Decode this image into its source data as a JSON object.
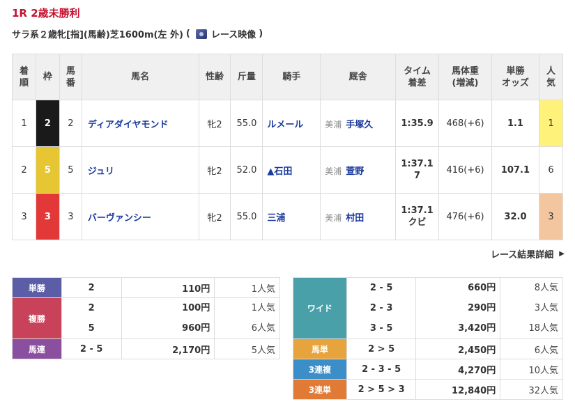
{
  "race": {
    "title": "1R 2歳未勝利",
    "condition": "サラ系２歳牝[指](馬齢)芝1600m(左 外)",
    "video_open": "(",
    "video_label": "レース映像",
    "video_close": ")"
  },
  "headers": {
    "rank": "着\n順",
    "waku": "枠",
    "umaban": "馬\n番",
    "name": "馬名",
    "sexage": "性齢",
    "weight": "斤量",
    "jockey": "騎手",
    "stable": "厩舎",
    "time": "タイム\n着差",
    "body": "馬体重\n(増減)",
    "odds": "単勝\nオッズ",
    "pop": "人\n気"
  },
  "rows": [
    {
      "rank": "1",
      "waku": "2",
      "waku_bg": "#1a1a1a",
      "waku_fg": "#ffffff",
      "umaban": "2",
      "name": "ディアダイヤモンド",
      "sexage": "牝2",
      "weight": "55.0",
      "jockey": "ルメール",
      "loc": "美浦",
      "trainer": "手塚久",
      "time": "1:35.9",
      "margin": "",
      "body": "468(+6)",
      "odds": "1.1",
      "pop": "1"
    },
    {
      "rank": "2",
      "waku": "5",
      "waku_bg": "#e6c733",
      "waku_fg": "#ffffff",
      "umaban": "5",
      "name": "ジュリ",
      "sexage": "牝2",
      "weight": "52.0",
      "jockey": "▲石田",
      "loc": "美浦",
      "trainer": "萱野",
      "time": "1:37.1",
      "margin": "7",
      "body": "416(+6)",
      "odds": "107.1",
      "pop": "6"
    },
    {
      "rank": "3",
      "waku": "3",
      "waku_bg": "#e23838",
      "waku_fg": "#ffffff",
      "umaban": "3",
      "name": "バーヴァンシー",
      "sexage": "牝2",
      "weight": "55.0",
      "jockey": "三浦",
      "loc": "美浦",
      "trainer": "村田",
      "time": "1:37.1",
      "margin": "クビ",
      "body": "476(+6)",
      "odds": "32.0",
      "pop": "3"
    }
  ],
  "detail_link": "レース結果詳細",
  "payout_left": [
    {
      "label": "単勝",
      "color": "#5b5ea6",
      "nums": [
        "2"
      ],
      "pays": [
        "110円"
      ],
      "pops": [
        "1人気"
      ]
    },
    {
      "label": "複勝",
      "color": "#c8435a",
      "nums": [
        "2",
        "5"
      ],
      "pays": [
        "100円",
        "960円"
      ],
      "pops": [
        "1人気",
        "6人気"
      ]
    },
    {
      "label": "馬連",
      "color": "#8b4fa0",
      "nums": [
        "2 - 5"
      ],
      "pays": [
        "2,170円"
      ],
      "pops": [
        "5人気"
      ]
    }
  ],
  "payout_right": [
    {
      "label": "ワイド",
      "color": "#4aa0a8",
      "nums": [
        "2 - 5",
        "2 - 3",
        "3 - 5"
      ],
      "pays": [
        "660円",
        "290円",
        "3,420円"
      ],
      "pops": [
        "8人気",
        "3人気",
        "18人気"
      ]
    },
    {
      "label": "馬単",
      "color": "#e8a43c",
      "nums": [
        "2 > 5"
      ],
      "pays": [
        "2,450円"
      ],
      "pops": [
        "6人気"
      ]
    },
    {
      "label": "3連複",
      "color": "#3c8ec8",
      "nums": [
        "2 - 3 - 5"
      ],
      "pays": [
        "4,270円"
      ],
      "pops": [
        "10人気"
      ]
    },
    {
      "label": "3連単",
      "color": "#e07a35",
      "nums": [
        "2 > 5 > 3"
      ],
      "pays": [
        "12,840円"
      ],
      "pops": [
        "32人気"
      ]
    }
  ]
}
